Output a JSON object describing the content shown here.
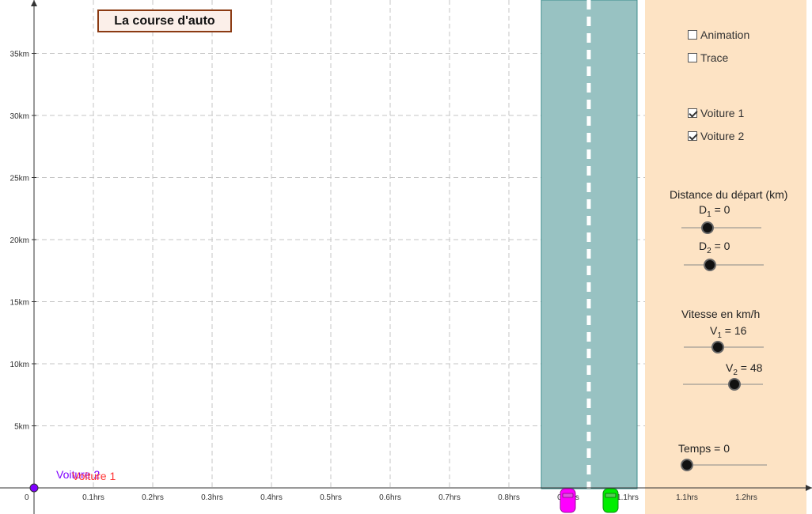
{
  "title": "La course d'auto",
  "chart_data": {
    "type": "scatter",
    "x_ticks": [
      "0.1hrs",
      "0.2hrs",
      "0.3hrs",
      "0.4hrs",
      "0.5hrs",
      "0.6hrs",
      "0.7hrs",
      "0.8hrs",
      "0.9hrs",
      "1.1hrs",
      "1.1hrs",
      "1.2hrs"
    ],
    "x_tick_values": [
      0.1,
      0.2,
      0.3,
      0.4,
      0.5,
      0.6,
      0.7,
      0.8,
      0.9,
      1.0,
      1.1,
      1.2
    ],
    "y_ticks": [
      "5km",
      "10km",
      "15km",
      "20km",
      "25km",
      "30km",
      "35km"
    ],
    "y_tick_values": [
      5,
      10,
      15,
      20,
      25,
      30,
      35
    ],
    "origin_label": "0",
    "xlim": [
      0,
      1.3
    ],
    "ylim": [
      0,
      38
    ],
    "grid": true,
    "points": [
      {
        "name": "Voiture 2",
        "x": 0,
        "y": 0,
        "color": "#7f00ff"
      },
      {
        "name": "Voiture 1",
        "x": 0,
        "y": 0,
        "color": "#ff3333"
      }
    ]
  },
  "checkboxes": [
    {
      "label": "Animation",
      "checked": false
    },
    {
      "label": "Trace",
      "checked": false
    },
    {
      "label": "Voiture 1",
      "checked": true
    },
    {
      "label": "Voiture 2",
      "checked": true
    }
  ],
  "distance_header": "Distance du départ (km)",
  "speed_header": "Vitesse en km/h",
  "sliders": {
    "d1": {
      "name": "D",
      "sub": "1",
      "value_text": "= 0",
      "value": 0
    },
    "d2": {
      "name": "D",
      "sub": "2",
      "value_text": "= 0",
      "value": 0
    },
    "v1": {
      "name": "V",
      "sub": "1",
      "value_text": "= 16",
      "value": 16
    },
    "v2": {
      "name": "V",
      "sub": "2",
      "value_text": "= 48",
      "value": 48
    },
    "temps": {
      "label": "Temps = 0",
      "value": 0
    }
  },
  "colors": {
    "road": "#98c2c2",
    "panel": "#fde3c4",
    "car1": "#ff00ff",
    "car2": "#00ee00",
    "title_border": "#8b3a12"
  }
}
